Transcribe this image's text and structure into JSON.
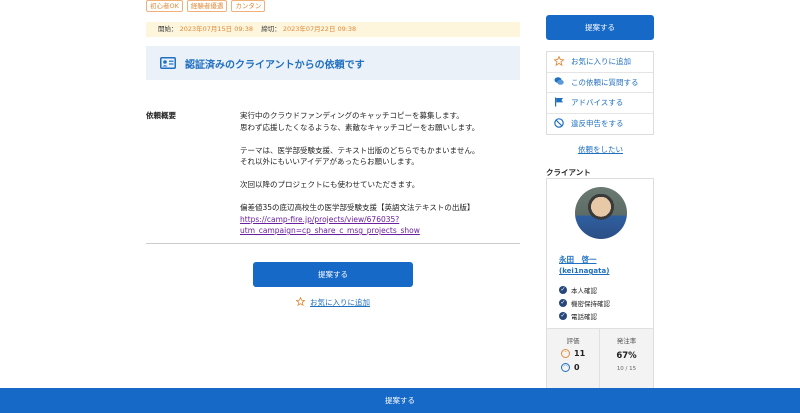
{
  "tags": [
    "初心者OK",
    "経験者優遇",
    "カンタン"
  ],
  "period": {
    "start_label": "開始：",
    "start_date": "2023年07月15日 09:38",
    "end_label": "締切：",
    "end_date": "2023年07月22日 09:38"
  },
  "verified": {
    "title": "認証済みのクライアントからの依頼です",
    "icon": "id-card-icon"
  },
  "details": {
    "label": "依頼概要",
    "line1": "実行中のクラウドファンディングのキャッチコピーを募集します。",
    "line2": "思わず応援したくなるような、素敵なキャッチコピーをお願いします。",
    "line3": "テーマは、医学部受験支援、テキスト出版のどちらでもかまいません。",
    "line4": "それ以外にもいいアイデアがあったらお願いします。",
    "line5": "次回以降のプロジェクトにも使わせていただきます。",
    "line6": "偏差値35の底辺高校生の医学部受験支援【英語文法テキストの出版】",
    "link_line1": "https://camp-fire.jp/projects/view/676035?",
    "link_line2": "utm_campaign=cp_share_c_msg_projects_show"
  },
  "main_cta": {
    "propose": "提案する",
    "favorite": "お気に入りに追加"
  },
  "sidebar": {
    "propose": "提案する",
    "menu": [
      {
        "label": "お気に入りに追加",
        "icon": "star-icon"
      },
      {
        "label": "この依頼に質問する",
        "icon": "chat-bubbles-icon"
      },
      {
        "label": "アドバイスする",
        "icon": "flag-icon"
      },
      {
        "label": "違反申告をする",
        "icon": "prohibited-icon"
      }
    ],
    "want_request": "依頼をしたい",
    "client_heading": "クライアント"
  },
  "client": {
    "name": "永田　啓一",
    "handle": "(kei1nagata)",
    "checks": [
      "本人確認",
      "機密保持確認",
      "電話確認"
    ],
    "rating_label": "評価",
    "good_count": "11",
    "bad_count": "0",
    "order_rate_label": "発注率",
    "order_rate": "67%",
    "order_fraction": "10 / 15"
  },
  "bottom_bar": {
    "propose": "提案する"
  },
  "colors": {
    "accent": "#1769c8",
    "link": "#1f6fc2",
    "tag": "#e08a3a",
    "period_bg": "#fdf6dd",
    "banner_bg": "#eaf1f8"
  }
}
